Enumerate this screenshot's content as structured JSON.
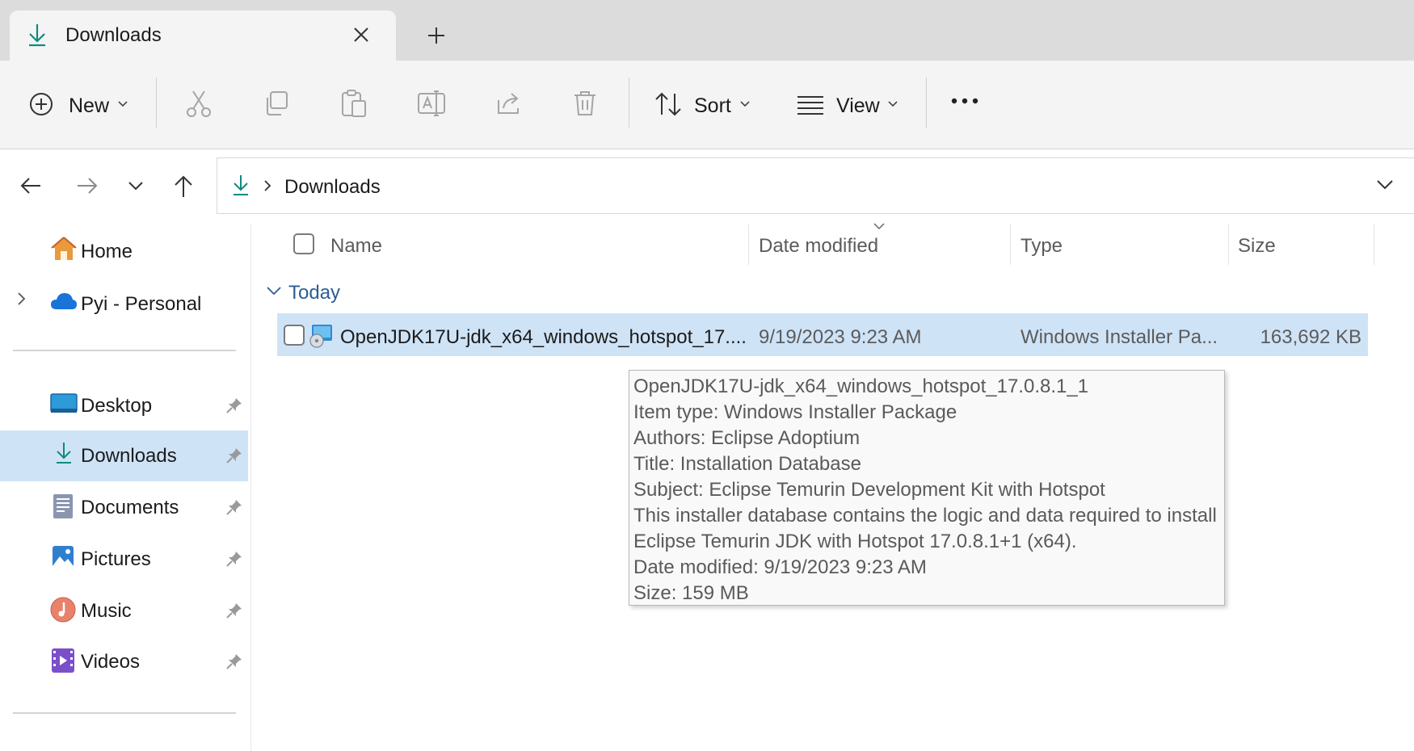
{
  "tab": {
    "title": "Downloads",
    "close_icon": "close-icon",
    "new_tab_icon": "plus-icon"
  },
  "toolbar": {
    "new_label": "New",
    "sort_label": "Sort",
    "view_label": "View"
  },
  "address": {
    "path": "Downloads"
  },
  "sidebar": {
    "home": "Home",
    "onedrive": "Pyi - Personal",
    "pinned": [
      {
        "label": "Desktop"
      },
      {
        "label": "Downloads"
      },
      {
        "label": "Documents"
      },
      {
        "label": "Pictures"
      },
      {
        "label": "Music"
      },
      {
        "label": "Videos"
      }
    ]
  },
  "list": {
    "columns": {
      "name": "Name",
      "date": "Date modified",
      "type": "Type",
      "size": "Size"
    },
    "group": "Today",
    "rows": [
      {
        "name": "OpenJDK17U-jdk_x64_windows_hotspot_17....",
        "date": "9/19/2023 9:23 AM",
        "type": "Windows Installer Pa...",
        "size": "163,692 KB"
      }
    ]
  },
  "tooltip": {
    "lines": [
      "OpenJDK17U-jdk_x64_windows_hotspot_17.0.8.1_1",
      "Item type: Windows Installer Package",
      "Authors: Eclipse Adoptium",
      "Title: Installation Database",
      "Subject: Eclipse Temurin Development Kit with Hotspot",
      "This installer database contains the logic and data required to install",
      "Eclipse Temurin JDK with Hotspot 17.0.8.1+1 (x64).",
      "Date modified: 9/19/2023 9:23 AM",
      "Size: 159 MB"
    ]
  },
  "colors": {
    "accent": "#0f8a7e",
    "selection": "#cfe3f7"
  }
}
